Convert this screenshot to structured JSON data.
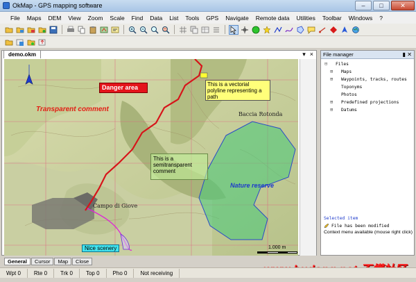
{
  "window": {
    "title": "OkMap - GPS mapping software"
  },
  "menu": [
    "File",
    "Maps",
    "DEM",
    "View",
    "Zoom",
    "Scale",
    "Find",
    "Data",
    "List",
    "Tools",
    "GPS",
    "Navigate",
    "Remote data",
    "Utilities",
    "Toolbar",
    "Windows",
    "?"
  ],
  "document": {
    "tab_label": "demo.okm",
    "pin": "▾",
    "close": "×"
  },
  "map": {
    "danger_label": "Danger area",
    "vector_label": "This is a vectorial polyline representing a path",
    "semi_label": "This is a semitransparent comment",
    "transparent_label": "Transparent comment",
    "nature_label": "Nature reserve",
    "scenery_label": "Nice scenery",
    "town_1": "Baccia Rotonda",
    "town_2": "Campo di Giove",
    "scale_label": "1.000 m",
    "colors": {
      "path": "#d7141a",
      "reserve": "#2e8b3c",
      "pink_path": "#e020d8",
      "grid": "#e06080"
    }
  },
  "bottom_tabs": [
    "General",
    "Cursor",
    "Map",
    "Close"
  ],
  "status": {
    "wpt": "Wpt 0",
    "rte": "Rte 0",
    "trk": "Trk 0",
    "top": "Top 0",
    "pho": "Pho 0",
    "recv": "Not receiving"
  },
  "watermark": "www.budong.net 不懂社区",
  "file_manager": {
    "title": "File manager",
    "ctrls": "▮ ✕",
    "tree": [
      {
        "label": "Files",
        "indent": 1,
        "toggle": "⊟"
      },
      {
        "label": "Maps",
        "indent": 2,
        "toggle": "⊞"
      },
      {
        "label": "Waypoints, tracks, routes",
        "indent": 2,
        "toggle": "⊞"
      },
      {
        "label": "Toponyms",
        "indent": 2,
        "toggle": ""
      },
      {
        "label": "Photos",
        "indent": 2,
        "toggle": ""
      },
      {
        "label": "Predefined projections",
        "indent": 2,
        "toggle": "⊞"
      },
      {
        "label": "Datums",
        "indent": 2,
        "toggle": "⊞"
      }
    ],
    "selected_title": "Selected item",
    "selected_value": "File has been modified",
    "context_hint": "Context menu available (mouse right click)"
  },
  "toolbar_icons": {
    "row1": [
      "open-icon",
      "open-map-icon",
      "save-map-icon",
      "open-data-icon",
      "save-data-icon",
      "print-icon",
      "copy-icon",
      "paste-icon",
      "calibrate-icon",
      "properties-icon",
      "zoom-in-icon",
      "zoom-out-icon",
      "zoom-fit-icon",
      "zoom-window-icon",
      "grid-icon",
      "copy2-icon",
      "table-icon",
      "list-icon",
      "select-icon",
      "crosshair-icon",
      "gps-icon",
      "waypoint-icon",
      "route-icon",
      "track-icon",
      "polygon-icon",
      "comment-icon",
      "link-icon",
      "diamond-icon",
      "arrow-icon",
      "globe-icon"
    ],
    "row2": [
      "tb2-open-icon",
      "tb2-layer-icon",
      "tb2-import-icon",
      "tb2-export-icon"
    ]
  }
}
